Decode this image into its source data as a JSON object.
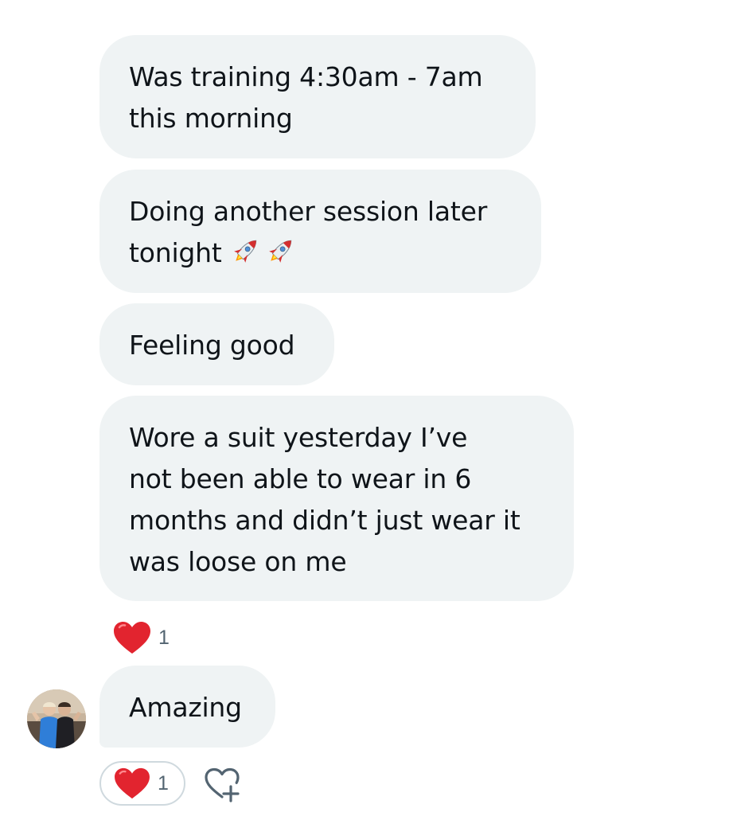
{
  "messages": [
    {
      "text_line1": "Was training 4:30am - 7am",
      "text_line2": "this morning"
    },
    {
      "text_line1": "Doing another session later",
      "text_line2": "tonight",
      "emoji": [
        "rocket-icon",
        "rocket-icon"
      ]
    },
    {
      "text_line1": "Feeling good"
    },
    {
      "text_line1": "Wore a suit yesterday I’ve",
      "text_line2": "not been able to wear in 6",
      "text_line3": "months and didn’t just wear it",
      "text_line4": "was loose on me"
    }
  ],
  "reaction_after_suit": {
    "icon": "heart-icon",
    "count": "1"
  },
  "reply": {
    "text": "Amazing",
    "avatar": "avatar"
  },
  "reply_reaction": {
    "icon": "heart-icon",
    "count": "1"
  },
  "add_reaction": {
    "icon": "add-reaction-icon"
  },
  "colors": {
    "bubble": "#eff3f4",
    "text": "#0f1419",
    "muted": "#536471",
    "heart": "#f4212e",
    "pill_border": "#cfd9de"
  }
}
